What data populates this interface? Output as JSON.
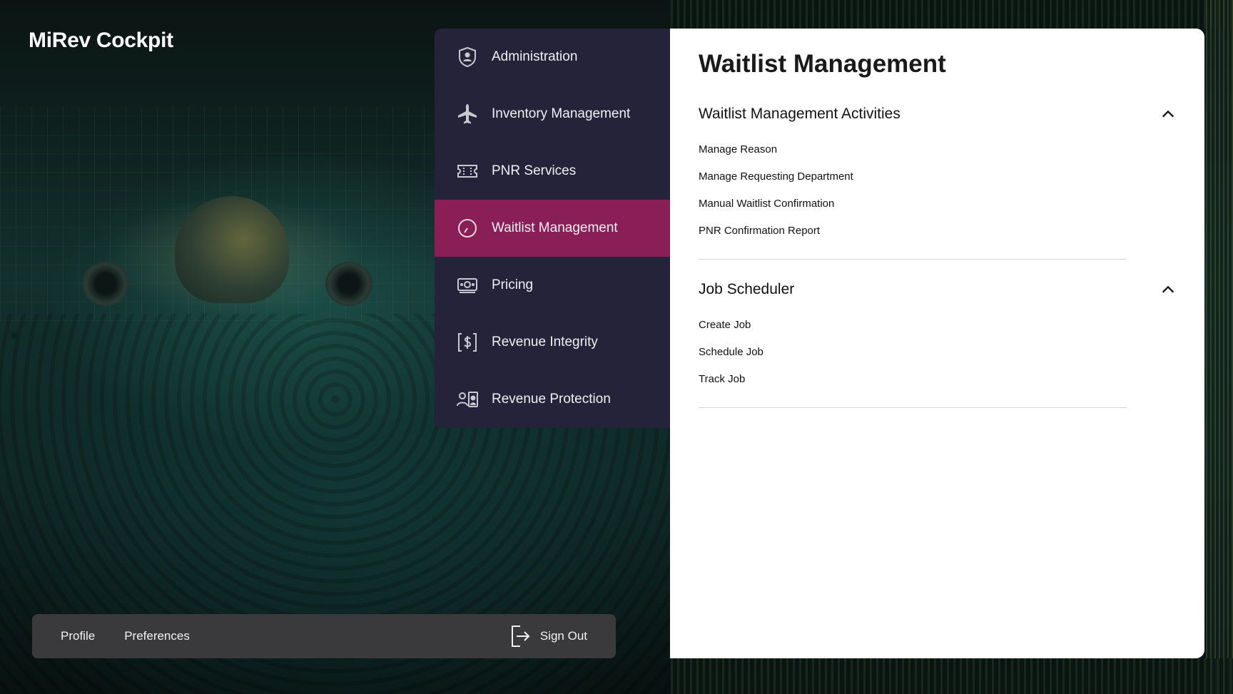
{
  "app": {
    "title": "MiRev Cockpit"
  },
  "colors": {
    "menu_bg": "#24233a",
    "active": "#8a1f57",
    "panel_bg": "#ffffff",
    "userbar_bg": "#3a3a3c"
  },
  "menu": {
    "items": [
      {
        "label": "Administration",
        "icon": "shield-user-icon",
        "active": false
      },
      {
        "label": "Inventory Management",
        "icon": "airplane-icon",
        "active": false
      },
      {
        "label": "PNR Services",
        "icon": "ticket-icon",
        "active": false
      },
      {
        "label": "Waitlist Management",
        "icon": "clock-icon",
        "active": true
      },
      {
        "label": "Pricing",
        "icon": "banknote-icon",
        "active": false
      },
      {
        "label": "Revenue Integrity",
        "icon": "dollar-bracket-icon",
        "active": false
      },
      {
        "label": "Revenue Protection",
        "icon": "person-badge-icon",
        "active": false
      }
    ]
  },
  "panel": {
    "title": "Waitlist Management",
    "sections": [
      {
        "title": "Waitlist Management Activities",
        "expanded": true,
        "links": [
          "Manage Reason",
          "Manage Requesting Department",
          "Manual Waitlist Confirmation",
          "PNR Confirmation Report"
        ]
      },
      {
        "title": "Job Scheduler",
        "expanded": true,
        "links": [
          "Create Job",
          "Schedule Job",
          "Track Job"
        ]
      }
    ]
  },
  "userbar": {
    "profile_label": "Profile",
    "preferences_label": "Preferences",
    "signout_label": "Sign Out"
  }
}
